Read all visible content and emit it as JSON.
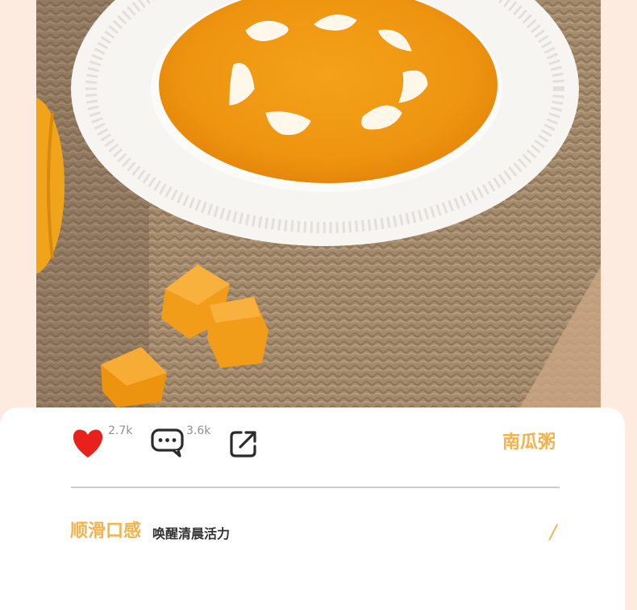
{
  "post": {
    "image_alt": "pumpkin soup photo",
    "likes": "2.7k",
    "comments": "3.6k",
    "tag": "南瓜粥",
    "headline": "顺滑口感",
    "subline": "唤醒清晨活力",
    "slash": "/"
  },
  "colors": {
    "accent": "#f5b14b",
    "like_red": "#e8211c",
    "background": "#fdebdf"
  },
  "icons": [
    "heart-icon",
    "comment-icon",
    "share-icon"
  ]
}
